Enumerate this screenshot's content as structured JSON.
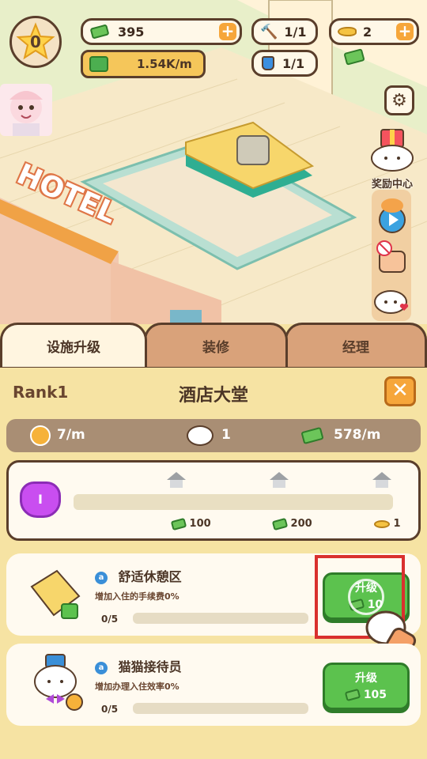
{
  "hud": {
    "level": "0",
    "cash": "395",
    "income_rate": "1.54K/m",
    "hammer": "1/1",
    "fish": "2",
    "potion": "1/1"
  },
  "side_menu": {
    "reward_center": "奖励中心"
  },
  "scene": {
    "hotel_sign": "HOTEL"
  },
  "tabs": [
    {
      "label": "设施升级",
      "active": true
    },
    {
      "label": "装修",
      "active": false
    },
    {
      "label": "经理",
      "active": false
    }
  ],
  "panel": {
    "rank": "Rank1",
    "title": "酒店大堂",
    "stats": {
      "time": "7/m",
      "cats": "1",
      "income": "578/m"
    },
    "progress": {
      "cat_level": "I",
      "milestones": [
        {
          "cost": "100"
        },
        {
          "cost": "200"
        },
        {
          "cost": "1",
          "currency": "fish"
        }
      ]
    }
  },
  "upgrades": [
    {
      "name": "舒适休憩区",
      "desc": "增加入住的手续费0%",
      "progress": "0/5",
      "button_label": "升级",
      "cost": "10"
    },
    {
      "name": "猫猫接待员",
      "desc": "增加办理入住效率0%",
      "progress": "0/5",
      "button_label": "升级",
      "cost": "105"
    }
  ],
  "colors": {
    "accent_orange": "#f6a63a",
    "green": "#5cc24e",
    "highlight_red": "#d9302e"
  }
}
